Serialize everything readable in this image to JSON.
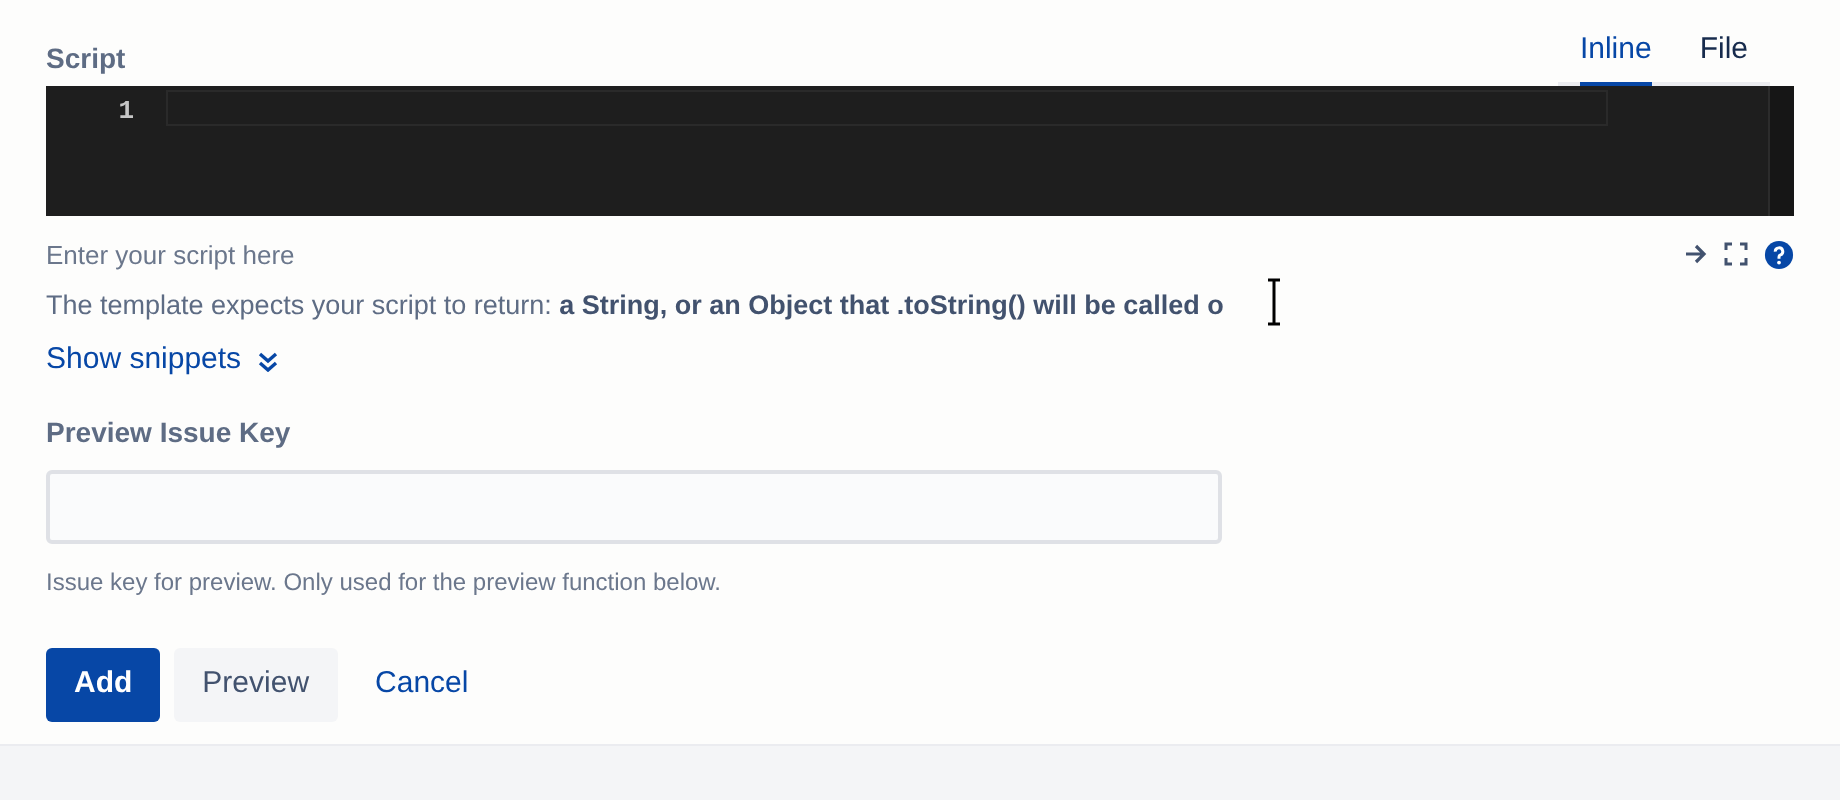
{
  "script_field": {
    "label": "Script",
    "tabs": [
      {
        "label": "Inline",
        "selected": true
      },
      {
        "label": "File",
        "selected": false
      }
    ],
    "editor": {
      "line_numbers": [
        "1"
      ]
    },
    "hint": "Enter your script here",
    "template_note": "The template expects your script to return: **a String, or an Object that .toString() will be called o**",
    "snippets_link": "Show snippets"
  },
  "preview_issue_key": {
    "label": "Preview Issue Key",
    "help": "Issue key for preview. Only used for the preview function below."
  },
  "buttons": [
    {
      "label": "Add",
      "kind": "primary"
    },
    {
      "label": "Preview",
      "kind": "default"
    },
    {
      "label": "Cancel",
      "kind": "link"
    }
  ]
}
